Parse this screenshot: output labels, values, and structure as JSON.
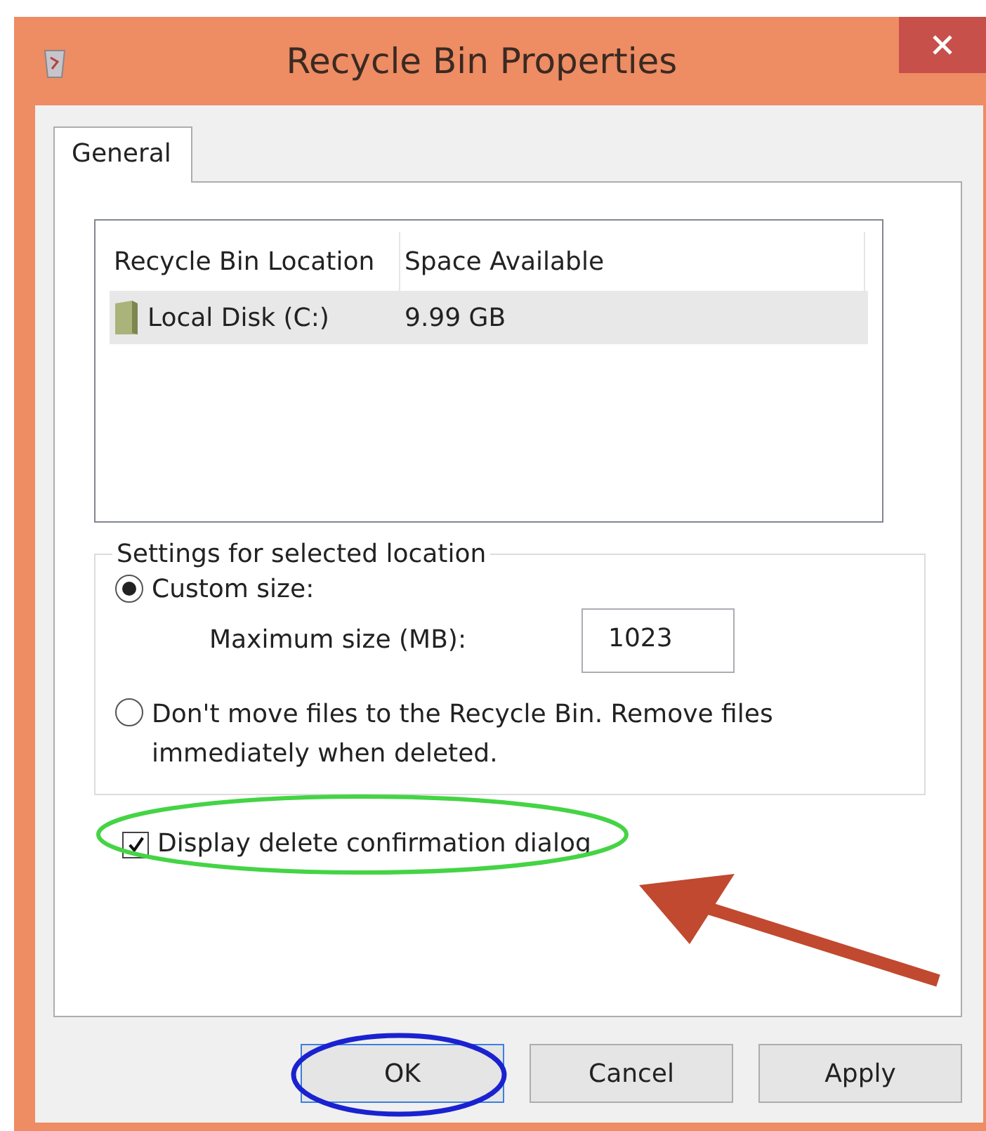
{
  "window": {
    "title": "Recycle Bin Properties"
  },
  "tabs": [
    {
      "label": "General",
      "selected": true
    }
  ],
  "location_list": {
    "columns": [
      "Recycle Bin Location",
      "Space Available"
    ],
    "rows": [
      {
        "cells": [
          "Local Disk (C:)",
          "9.99 GB"
        ],
        "selected": true
      }
    ]
  },
  "settings": {
    "legend": "Settings for selected location",
    "options": [
      {
        "label": "Custom size:",
        "selected": true
      },
      {
        "label": "Don't move files to the Recycle Bin. Remove files immediately when deleted.",
        "selected": false
      }
    ],
    "max_size": {
      "label": "Maximum size (MB):",
      "value": "1023"
    }
  },
  "confirm_checkbox": {
    "label": "Display delete confirmation dialog",
    "checked": true
  },
  "buttons": [
    {
      "label": "OK",
      "default": true
    },
    {
      "label": "Cancel",
      "default": false
    },
    {
      "label": "Apply",
      "default": false
    }
  ]
}
